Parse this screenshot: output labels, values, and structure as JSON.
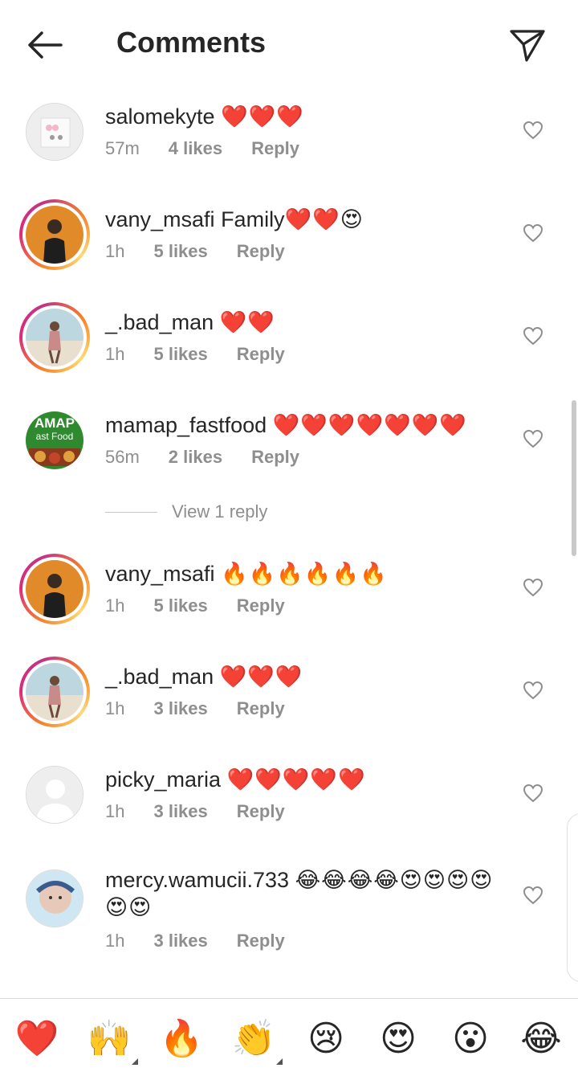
{
  "header": {
    "title": "Comments"
  },
  "comments": [
    {
      "username": "salomekyte",
      "body": "",
      "emojis": "❤️❤️❤️",
      "time": "57m",
      "likes": "4 likes",
      "reply": "Reply"
    },
    {
      "username": "vany_msafi",
      "body": " Family",
      "emojis": "❤️❤️😍",
      "time": "1h",
      "likes": "5 likes",
      "reply": "Reply"
    },
    {
      "username": "_.bad_man",
      "body": "",
      "emojis": "❤️❤️",
      "time": "1h",
      "likes": "5 likes",
      "reply": "Reply"
    },
    {
      "username": "mamap_fastfood",
      "body": "",
      "emojis": "❤️❤️❤️❤️❤️❤️❤️",
      "time": "56m",
      "likes": "2 likes",
      "reply": "Reply"
    },
    {
      "username": "vany_msafi",
      "body": "",
      "emojis": "🔥🔥🔥🔥🔥🔥",
      "time": "1h",
      "likes": "5 likes",
      "reply": "Reply"
    },
    {
      "username": "_.bad_man",
      "body": "",
      "emojis": "❤️❤️❤️",
      "time": "1h",
      "likes": "3 likes",
      "reply": "Reply"
    },
    {
      "username": "picky_maria",
      "body": "",
      "emojis": "❤️❤️❤️❤️❤️",
      "time": "1h",
      "likes": "3 likes",
      "reply": "Reply"
    },
    {
      "username": "mercy.wamucii.733",
      "body": "",
      "emojis": "😂😂😂😂😍😍😍😍😍😍",
      "time": "1h",
      "likes": "3 likes",
      "reply": "Reply"
    }
  ],
  "view_replies": "View 1 reply",
  "avatar_text": {
    "mamap_logo_top": "AMAP",
    "mamap_logo_bottom": "ast Food"
  },
  "reactions": [
    "❤️",
    "🙌",
    "🔥",
    "👏",
    "😢",
    "😍",
    "😮",
    "😂"
  ],
  "colors": {
    "accent_heart": "#e0245e",
    "meta_gray": "#8e8e8e",
    "text": "#262626"
  },
  "icons": {
    "back": "back-arrow-icon",
    "send": "send-icon",
    "like": "heart-outline-icon"
  }
}
